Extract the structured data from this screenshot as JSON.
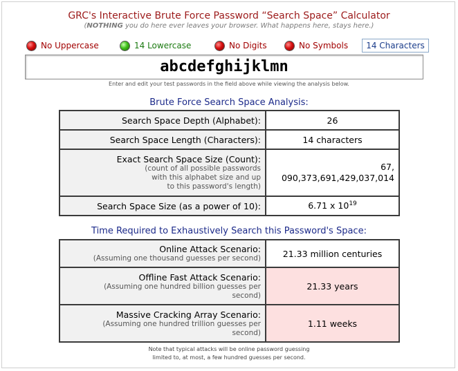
{
  "header": {
    "title": "GRC's Interactive Brute Force Password “Search Space” Calculator",
    "subtitle_strong": "NOTHING",
    "subtitle_pre": "(",
    "subtitle_rest": " you do here ever leaves your browser. What happens here, stays here.)"
  },
  "indicators": [
    {
      "label": "No Uppercase",
      "status": "red"
    },
    {
      "label": "14 Lowercase",
      "status": "green"
    },
    {
      "label": "No Digits",
      "status": "red"
    },
    {
      "label": "No Symbols",
      "status": "red"
    }
  ],
  "char_count_label": "14 Characters",
  "password": {
    "value": "abcdefghijklmn",
    "hint": "Enter and edit your test passwords in the field above while viewing the analysis below."
  },
  "analysis": {
    "heading": "Brute Force Search Space Analysis:",
    "depth_label": "Search Space Depth (Alphabet):",
    "depth_value": "26",
    "length_label": "Search Space Length (Characters):",
    "length_value": "14 characters",
    "exact_label": "Exact Search Space Size (Count):",
    "exact_sub1": "(count of all possible passwords",
    "exact_sub2": "with this alphabet size and up",
    "exact_sub3": "to this password's length)",
    "exact_value1": "67,",
    "exact_value2": "090,373,691,429,037,014",
    "power_label": "Search Space Size (as a power of 10):",
    "power_mantissa": "6.71 x 10",
    "power_exponent": "19"
  },
  "time": {
    "heading": "Time Required to Exhaustively Search this Password's Space:",
    "online_label": "Online Attack Scenario:",
    "online_sub": "(Assuming one thousand guesses per second)",
    "online_value": "21.33 million centuries",
    "offline_label": "Offline Fast Attack Scenario:",
    "offline_sub1": "(Assuming one hundred billion guesses per",
    "offline_sub2": "second)",
    "offline_value": "21.33 years",
    "massive_label": "Massive Cracking Array Scenario:",
    "massive_sub1": "(Assuming one hundred trillion guesses per",
    "massive_sub2": "second)",
    "massive_value": "1.11 weeks"
  },
  "footnote": {
    "line1": "Note that typical attacks will be online password guessing",
    "line2": "limited to, at most, a few hundred guesses per second."
  }
}
